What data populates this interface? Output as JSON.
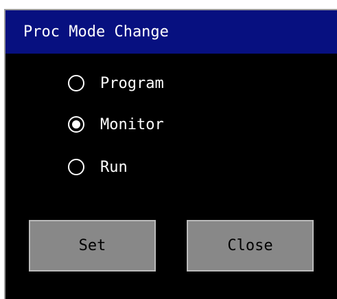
{
  "dialog": {
    "title": "Proc Mode Change",
    "options": [
      {
        "label": "Program",
        "selected": false
      },
      {
        "label": "Monitor",
        "selected": true
      },
      {
        "label": "Run",
        "selected": false
      }
    ],
    "buttons": {
      "set_label": "Set",
      "close_label": "Close"
    }
  },
  "colors": {
    "titlebar": "#071080",
    "background": "#000000",
    "text": "#ffffff",
    "button": "#888888"
  }
}
